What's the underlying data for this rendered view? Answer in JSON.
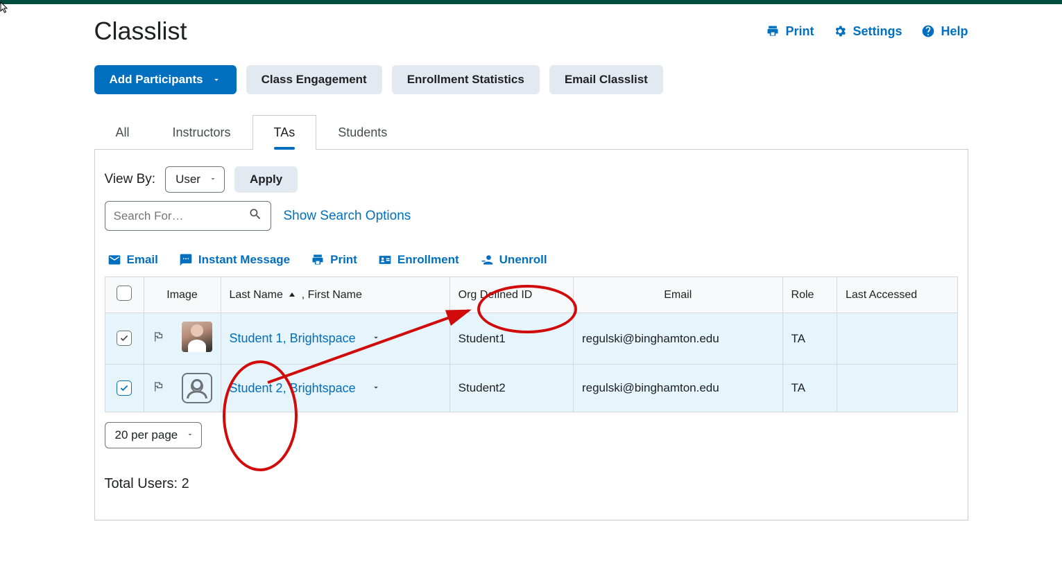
{
  "page_title": "Classlist",
  "header_actions": {
    "print": "Print",
    "settings": "Settings",
    "help": "Help"
  },
  "buttons": {
    "add_participants": "Add Participants",
    "class_engagement": "Class Engagement",
    "enrollment_statistics": "Enrollment Statistics",
    "email_classlist": "Email Classlist"
  },
  "tabs": {
    "all": "All",
    "instructors": "Instructors",
    "tas": "TAs",
    "students": "Students"
  },
  "viewby": {
    "label": "View By:",
    "value": "User",
    "apply": "Apply"
  },
  "search": {
    "placeholder": "Search For…",
    "show_options": "Show Search Options"
  },
  "bulk": {
    "email": "Email",
    "im": "Instant Message",
    "print": "Print",
    "enrollment": "Enrollment",
    "unenroll": "Unenroll"
  },
  "columns": {
    "image": "Image",
    "name_prefix": "Last Name",
    "name_suffix": ", First Name",
    "org_id": "Org Defined ID",
    "email": "Email",
    "role": "Role",
    "last_accessed": "Last Accessed"
  },
  "rows": [
    {
      "name": "Student 1, Brightspace",
      "org_id": "Student1",
      "email": "regulski@binghamton.edu",
      "role": "TA",
      "last_accessed": ""
    },
    {
      "name": "Student 2, Brightspace",
      "org_id": "Student2",
      "email": "regulski@binghamton.edu",
      "role": "TA",
      "last_accessed": ""
    }
  ],
  "pager": {
    "value": "20 per page"
  },
  "total_users": "Total Users: 2"
}
